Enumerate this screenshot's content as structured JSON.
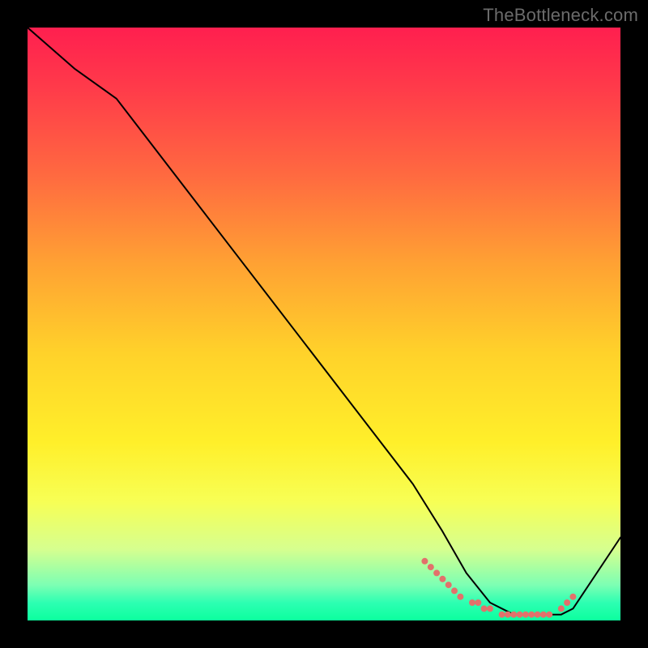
{
  "watermark": "TheBottleneck.com",
  "chart_data": {
    "type": "line",
    "title": "",
    "xlabel": "",
    "ylabel": "",
    "xlim": [
      0,
      100
    ],
    "ylim": [
      0,
      100
    ],
    "grid": false,
    "series": [
      {
        "name": "curve",
        "x": [
          0,
          8,
          15,
          25,
          35,
          45,
          55,
          65,
          70,
          74,
          78,
          82,
          86,
          90,
          92,
          100
        ],
        "y": [
          100,
          93,
          88,
          75,
          62,
          49,
          36,
          23,
          15,
          8,
          3,
          1,
          1,
          1,
          2,
          14
        ]
      }
    ],
    "marker_cluster": {
      "note": "dense markers along bottom of curve",
      "x": [
        67,
        68,
        69,
        70,
        71,
        72,
        73,
        75,
        76,
        77,
        78,
        80,
        81,
        82,
        83,
        84,
        85,
        86,
        87,
        88,
        90,
        91,
        92
      ],
      "y": [
        10,
        9,
        8,
        7,
        6,
        5,
        4,
        3,
        3,
        2,
        2,
        1,
        1,
        1,
        1,
        1,
        1,
        1,
        1,
        1,
        2,
        3,
        4
      ],
      "color": "#e2716b",
      "marker_size": 4
    },
    "background_gradient": {
      "top": "#ff1f4f",
      "mid": "#ffe02a",
      "bottom": "#0cff9e"
    }
  }
}
